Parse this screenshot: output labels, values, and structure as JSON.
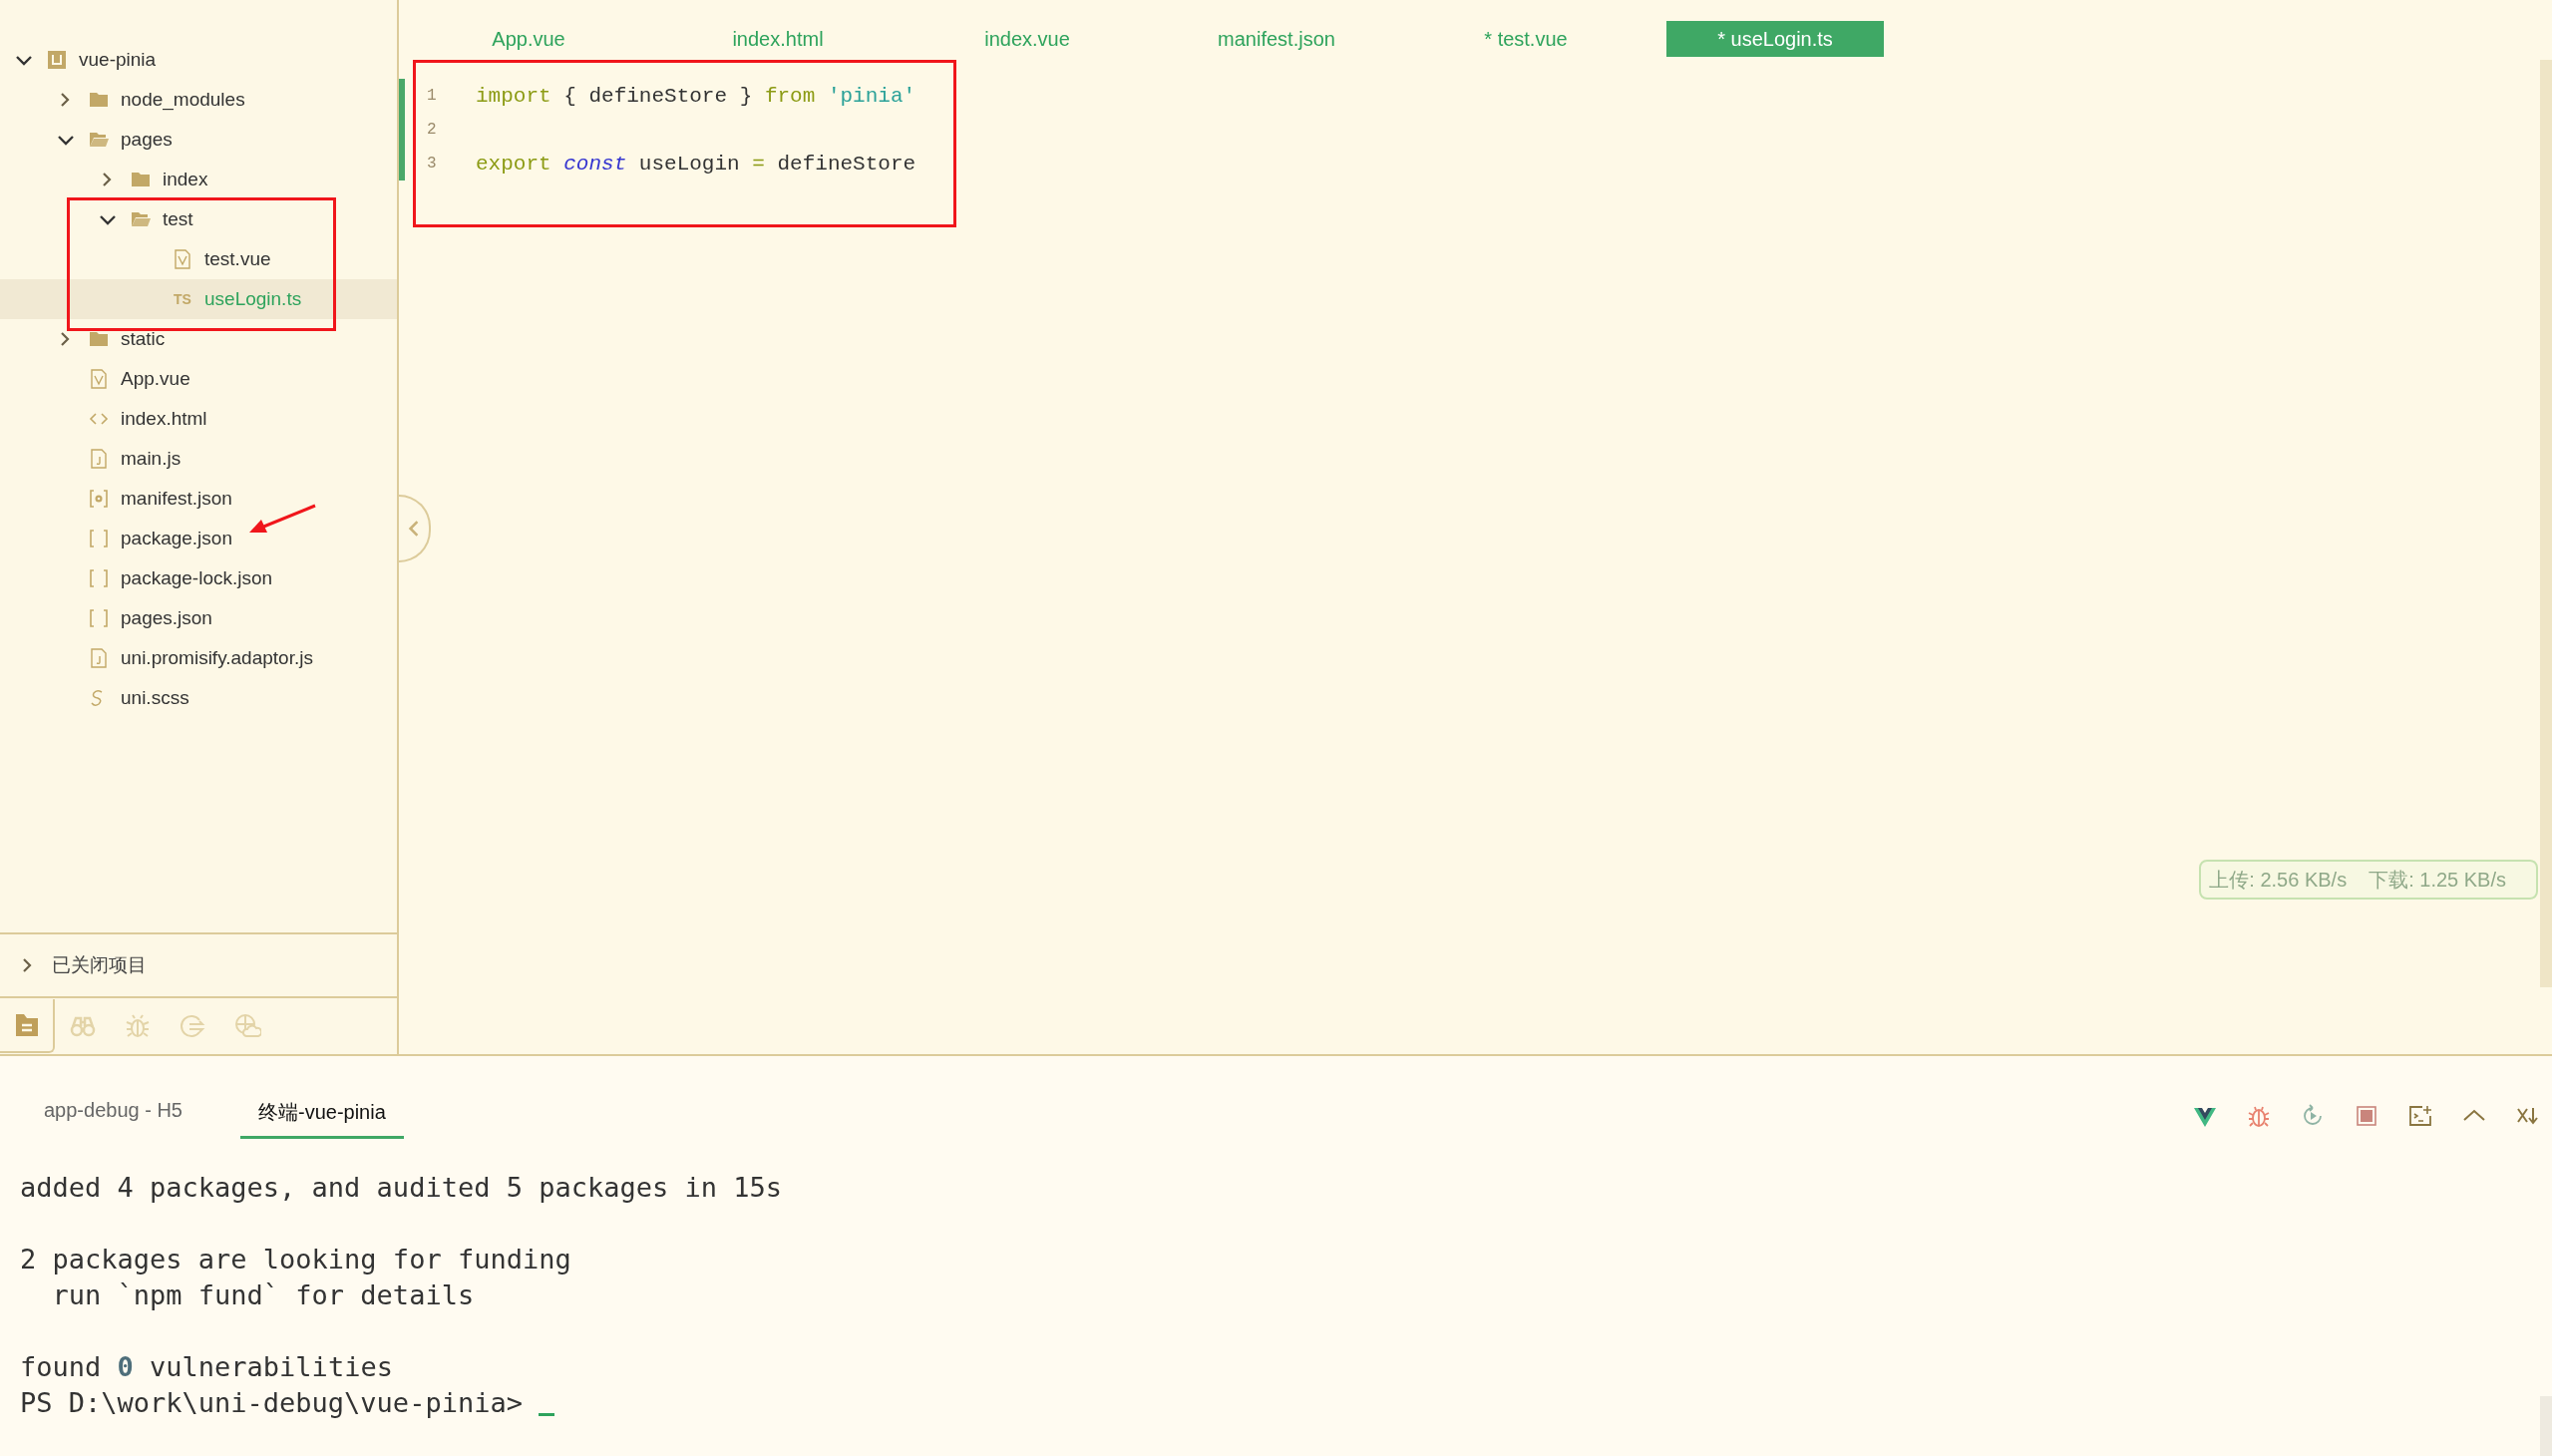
{
  "sidebar": {
    "tree": [
      {
        "kind": "project",
        "label": "vue-pinia",
        "expanded": true,
        "selected": false,
        "children": [
          {
            "kind": "folder",
            "label": "node_modules",
            "expanded": false,
            "selected": false
          },
          {
            "kind": "folder",
            "label": "pages",
            "expanded": true,
            "selected": false,
            "children": [
              {
                "kind": "folder",
                "label": "index",
                "expanded": false,
                "selected": false
              },
              {
                "kind": "folder",
                "label": "test",
                "expanded": true,
                "selected": false,
                "children": [
                  {
                    "kind": "vue",
                    "label": "test.vue",
                    "selected": false
                  },
                  {
                    "kind": "badge",
                    "icon_text": "TS",
                    "label": "useLogin.ts",
                    "selected": true
                  }
                ]
              }
            ]
          },
          {
            "kind": "folder",
            "label": "static",
            "expanded": false,
            "selected": false
          },
          {
            "kind": "vue",
            "label": "App.vue",
            "selected": false
          },
          {
            "kind": "html",
            "label": "index.html",
            "selected": false
          },
          {
            "kind": "js",
            "label": "main.js",
            "selected": false
          },
          {
            "kind": "manifest",
            "label": "manifest.json",
            "selected": false
          },
          {
            "kind": "json",
            "label": "package.json",
            "selected": false
          },
          {
            "kind": "json",
            "label": "package-lock.json",
            "selected": false
          },
          {
            "kind": "json",
            "label": "pages.json",
            "selected": false
          },
          {
            "kind": "js",
            "label": "uni.promisify.adaptor.js",
            "selected": false
          },
          {
            "kind": "scss",
            "label": "uni.scss",
            "selected": false
          }
        ]
      }
    ],
    "closed_projects": {
      "label": "已关闭项目",
      "expanded": false
    },
    "toolbar": [
      {
        "kind": "files",
        "selected": true
      },
      {
        "kind": "binoculars",
        "selected": false
      },
      {
        "kind": "bug",
        "selected": false
      },
      {
        "kind": "export",
        "selected": false
      },
      {
        "kind": "globe-cloud",
        "selected": false
      }
    ]
  },
  "editor": {
    "tabs": [
      {
        "label": "App.vue",
        "selected": false
      },
      {
        "label": "index.html",
        "selected": false
      },
      {
        "label": "index.vue",
        "selected": false
      },
      {
        "label": "manifest.json",
        "selected": false
      },
      {
        "label": "* test.vue",
        "selected": false
      },
      {
        "label": "* useLogin.ts",
        "selected": true
      }
    ],
    "lines": [
      {
        "number": "1",
        "tokens": [
          {
            "kind": "keyword",
            "text": "import"
          },
          {
            "kind": "plain",
            "text": " { defineStore } "
          },
          {
            "kind": "keyword",
            "text": "from"
          },
          {
            "kind": "string",
            "text": " 'pinia'"
          }
        ]
      },
      {
        "number": "2"
      },
      {
        "number": "3",
        "tokens": [
          {
            "kind": "keyword",
            "text": "export"
          },
          {
            "kind": "storage",
            "text": " const"
          },
          {
            "kind": "plain",
            "text": " useLogin "
          },
          {
            "kind": "operator",
            "text": "="
          },
          {
            "kind": "plain",
            "text": " defineStore"
          }
        ]
      }
    ],
    "network": {
      "upload": "上传: 2.56 KB/s",
      "download": "下载: 1.25 KB/s"
    }
  },
  "terminal": {
    "tabs": [
      {
        "label": "app-debug - H5",
        "selected": false
      },
      {
        "label": "终端-vue-pinia",
        "selected": true
      }
    ],
    "blocks": [
      [
        "added 4 packages, and audited 5 packages in 15s"
      ],
      [
        "2 packages are looking for funding",
        "  run `npm fund` for details"
      ],
      [
        "found **0** vulnerabilities",
        "PS D:\\work\\uni-debug\\vue-pinia> "
      ]
    ]
  }
}
